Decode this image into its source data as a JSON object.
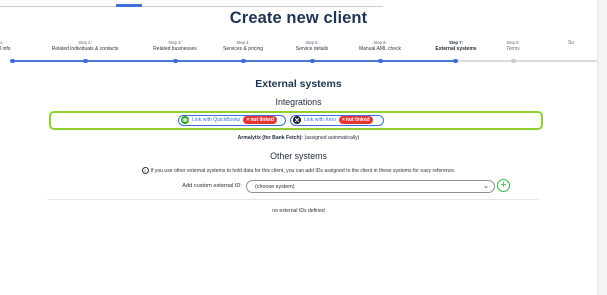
{
  "page": {
    "title": "Create new client"
  },
  "stepper": {
    "steps": [
      {
        "num": "1:",
        "label": "l info",
        "state": "done"
      },
      {
        "num": "Step 2:",
        "label": "Related individuals & contacts",
        "state": "done"
      },
      {
        "num": "Step 3:",
        "label": "Related businesses",
        "state": "done"
      },
      {
        "num": "Step 4:",
        "label": "Services & pricing",
        "state": "done"
      },
      {
        "num": "Step 5:",
        "label": "Service details",
        "state": "done"
      },
      {
        "num": "Step 6:",
        "label": "Manual AML check",
        "state": "done"
      },
      {
        "num": "Step 7:",
        "label": "External systems",
        "state": "active"
      },
      {
        "num": "Step 8:",
        "label": "Terms",
        "state": "upcoming"
      },
      {
        "num": "",
        "label": "Su",
        "state": "upcoming"
      }
    ]
  },
  "external": {
    "heading": "External systems",
    "integrations_heading": "Integrations",
    "quickbooks": {
      "icon": "quickbooks-logo-icon",
      "label": "Link with QuickBooks",
      "status": "not linked",
      "status_color": "#e53535"
    },
    "xero": {
      "icon": "xero-logo-icon",
      "label": "Link with Xero",
      "status": "not linked",
      "status_color": "#e53535"
    },
    "armalytix": {
      "label": "Armalytix (for Bank Fetch):",
      "value": "(assigned automatically)"
    }
  },
  "other": {
    "heading": "Other systems",
    "info": "If you use other external systems to hold data for this client, you can add IDs assigned to the client in these systems for easy reference.",
    "custom_label": "Add custom external ID:",
    "select_value": "(choose system)",
    "empty": "no external IDs defined"
  },
  "colors": {
    "accent": "#3f6fd8",
    "highlight": "#8ed12d",
    "add": "#39b54a",
    "danger": "#e53535"
  }
}
